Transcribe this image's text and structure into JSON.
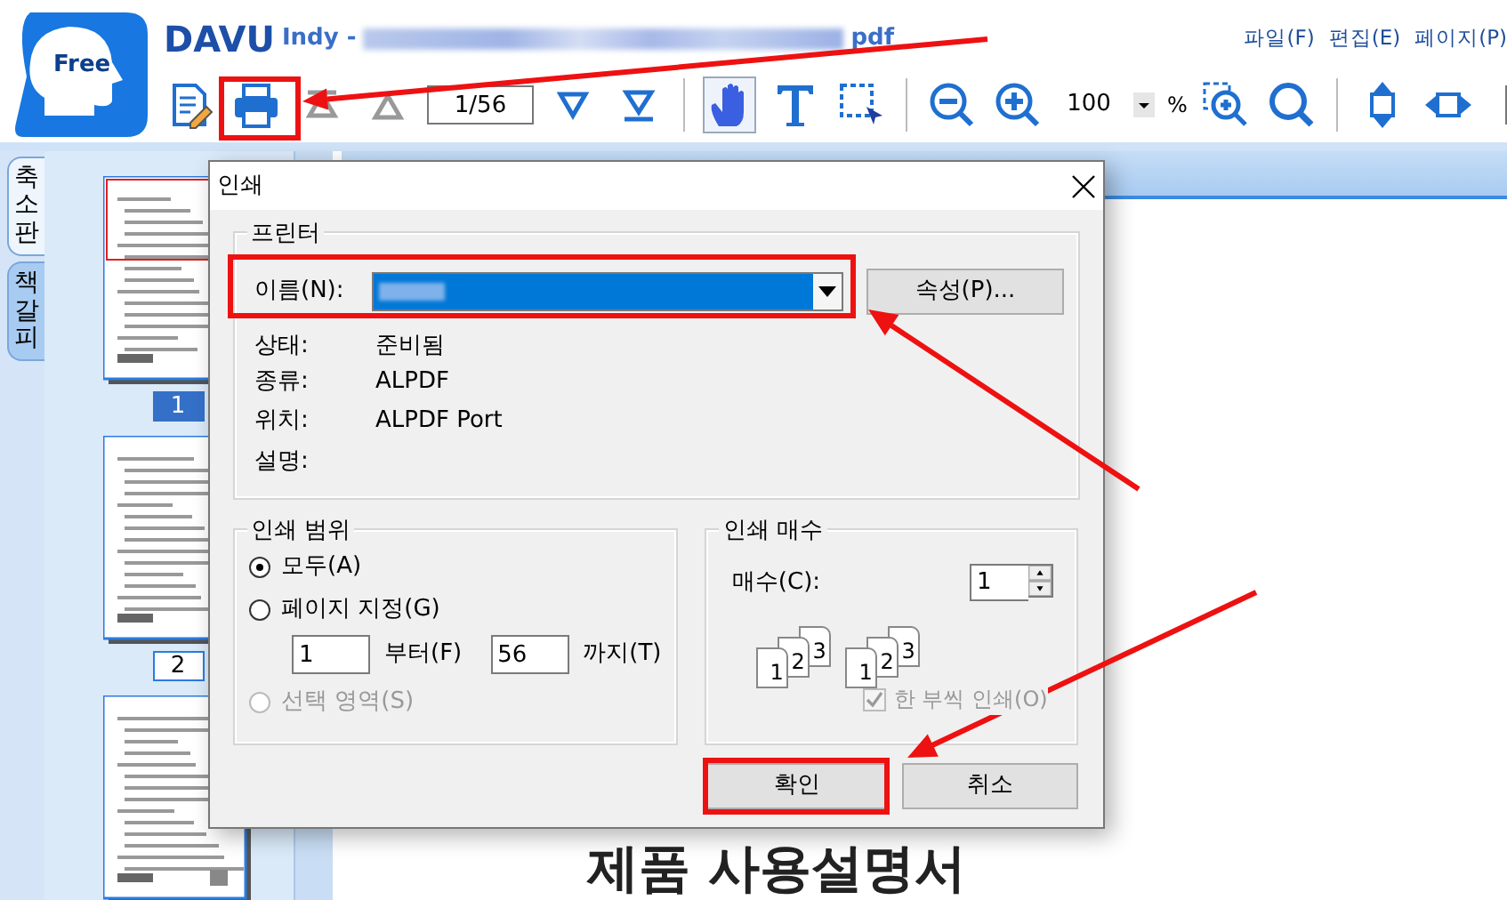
{
  "app": {
    "logo_label": "Free",
    "brand": "DAVU",
    "title_prefix": "Indy -",
    "title_suffix": "pdf"
  },
  "menu": [
    {
      "label": "파일(F)"
    },
    {
      "label": "편집(E)"
    },
    {
      "label": "페이지(P)"
    }
  ],
  "toolbar": {
    "page": "1/56",
    "zoom": "100",
    "zoom_unit": "%",
    "tools": [
      {
        "kind": "hand",
        "selected": true
      },
      {
        "kind": "text",
        "selected": false
      },
      {
        "kind": "select",
        "selected": false
      }
    ]
  },
  "side_tabs": [
    {
      "label": "축소판",
      "selected": true
    },
    {
      "label": "책갈피",
      "selected": false
    }
  ],
  "thumbnails": [
    {
      "page": "1",
      "selected": true
    },
    {
      "page": "2",
      "selected": false
    },
    {
      "selected": false
    }
  ],
  "document": {
    "heading": "제품 사용설명서"
  },
  "dialog": {
    "title": "인쇄",
    "printer": {
      "legend": "프린터",
      "name_label": "이름(N):",
      "properties_button": "속성(P)...",
      "info": [
        {
          "label": "상태:",
          "value": "준비됨"
        },
        {
          "label": "종류:",
          "value": "ALPDF"
        },
        {
          "label": "위치:",
          "value": "ALPDF Port"
        },
        {
          "label": "설명:"
        }
      ]
    },
    "range": {
      "legend": "인쇄 범위",
      "options": [
        {
          "kind": "all",
          "label": "모두(A)",
          "selected": true,
          "disabled": false
        },
        {
          "kind": "pages",
          "label": "페이지 지정(G)",
          "selected": false,
          "disabled": false
        },
        {
          "kind": "selection",
          "label": "선택 영역(S)",
          "selected": false,
          "disabled": true
        }
      ],
      "from": "1",
      "from_label": "부터(F)",
      "to": "56",
      "to_label": "까지(T)"
    },
    "copies": {
      "legend": "인쇄 매수",
      "count_label": "매수(C):",
      "count": "1",
      "collate_stacks": [
        [
          "1",
          "2",
          "3"
        ],
        [
          "1",
          "2",
          "3"
        ]
      ],
      "collate_label": "한 부씩 인쇄(O)",
      "collate_checked": true,
      "collate_disabled": true
    },
    "buttons": [
      {
        "label": "확인"
      },
      {
        "label": "취소"
      }
    ]
  }
}
